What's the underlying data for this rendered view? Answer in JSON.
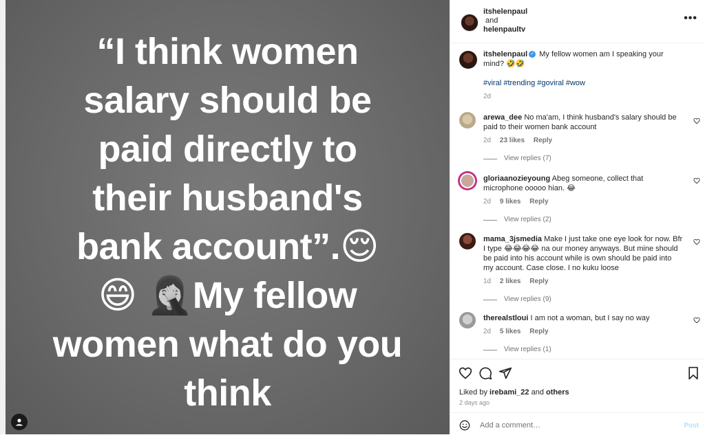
{
  "post": {
    "text_lines": [
      "“I think women",
      "salary should be",
      "paid directly to",
      "their husband's",
      "bank account”."
    ],
    "emoji_after_line5": "😌",
    "emoji_line6a": "😄",
    "emoji_line6b": "🤦‍♀️",
    "line6_text": "My fellow",
    "line7_text": "women what do you",
    "line8_text": "think"
  },
  "header": {
    "username1": "itshelenpaul",
    "and_text": "and",
    "username2": "helenpaultv",
    "more": "•••"
  },
  "caption": {
    "username": "itshelenpaul",
    "text": "My fellow women am I speaking your mind? 🤣🤣",
    "hashtags": "#viral #trending #goviral #wow",
    "time": "2d"
  },
  "comments": [
    {
      "username": "arewa_dee",
      "text": "No ma'am, I think husband's salary should be paid to their women bank account",
      "time": "2d",
      "likes": "23 likes",
      "reply": "Reply",
      "view_replies": "View replies (7)"
    },
    {
      "username": "gloriaanozieyoung",
      "text": "Abeg someone, collect that microphone ooooo hian. 😂",
      "time": "2d",
      "likes": "9 likes",
      "reply": "Reply",
      "view_replies": "View replies (2)"
    },
    {
      "username": "mama_3jsmedia",
      "text": "Make I just take one eye look for now. Bfr I type 😂😂😂😂 na our money anyways. But mine should be paid into his account while is own should be paid into my account. Case close. I no kuku loose",
      "time": "1d",
      "likes": "2 likes",
      "reply": "Reply",
      "view_replies": "View replies (9)"
    },
    {
      "username": "therealstloui",
      "text": "I am not a woman, but I say no way",
      "time": "2d",
      "likes": "5 likes",
      "reply": "Reply",
      "view_replies": "View replies (1)"
    }
  ],
  "likes_bar": {
    "prefix": "Liked by",
    "user": "irebami_22",
    "middle": "and",
    "others": "others",
    "time_ago": "2 days ago"
  },
  "add_comment": {
    "placeholder": "Add a comment…",
    "post_label": "Post"
  },
  "colors": {
    "link_blue": "#00376b",
    "verified_blue": "#3897f0",
    "post_disabled": "#b2dffc"
  }
}
